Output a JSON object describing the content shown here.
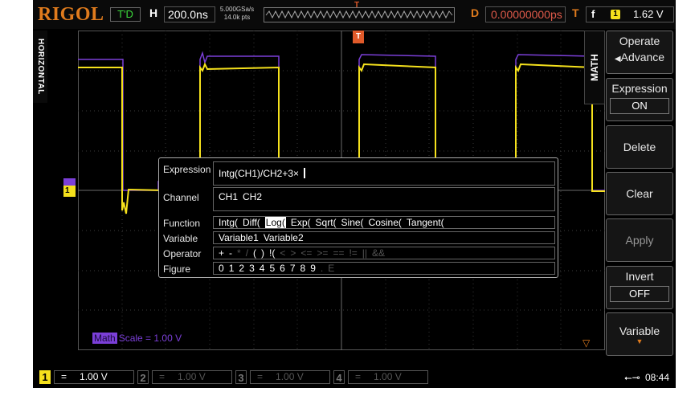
{
  "brand": "RIGOL",
  "top": {
    "run_status": "T'D",
    "h_label": "H",
    "timebase": "200.0ns",
    "sample_rate": "5.000GSa/s",
    "mem_depth": "14.0k pts",
    "trigger_marker": "T",
    "d_label": "D",
    "delay": "0.00000000ps",
    "t_label": "T",
    "trigger_edge": "f",
    "trigger_source": "1",
    "trigger_level": "1.62 V"
  },
  "left_label": "HORIZONTAL",
  "ch1_marker": "1",
  "grid_trigger_marker": "T",
  "math_scale": {
    "tag": "Math",
    "text": "Scale = 1.00 V"
  },
  "dialog": {
    "expression": {
      "label": "Expression",
      "value": "Intg(CH1)/CH2+3×"
    },
    "channel": {
      "label": "Channel",
      "items": [
        "CH1",
        "CH2"
      ]
    },
    "function": {
      "label": "Function",
      "items": [
        "Intg(",
        "Diff(",
        "Log(",
        "Exp(",
        "Sqrt(",
        "Sine(",
        "Cosine(",
        "Tangent("
      ],
      "selected_index": 2
    },
    "variable": {
      "label": "Variable",
      "items": [
        "Variable1",
        "Variable2"
      ]
    },
    "operator": {
      "label": "Operator",
      "active": [
        "+",
        "-"
      ],
      "inactive": [
        "*",
        "/",
        "(",
        ")",
        "!(",
        "<",
        ">",
        "<=",
        ">=",
        "==",
        "!=",
        "||",
        "&&"
      ]
    },
    "figure": {
      "label": "Figure",
      "digits": [
        "0",
        "1",
        "2",
        "3",
        "4",
        "5",
        "6",
        "7",
        "8",
        "9"
      ],
      "dim": [
        ".",
        "E"
      ]
    }
  },
  "menu": {
    "tab": "MATH",
    "operate_label": "Operate",
    "operate_value": "Advance",
    "expression_label": "Expression",
    "expression_value": "ON",
    "delete_label": "Delete",
    "clear_label": "Clear",
    "apply_label": "Apply",
    "invert_label": "Invert",
    "invert_value": "OFF",
    "variable_label": "Variable"
  },
  "channels": [
    {
      "num": "1",
      "coupling": "=",
      "scale": "1.00 V",
      "color": "#f5e11c",
      "active": true
    },
    {
      "num": "2",
      "coupling": "=",
      "scale": "1.00 V",
      "color": "#555555",
      "active": false
    },
    {
      "num": "3",
      "coupling": "=",
      "scale": "1.00 V",
      "color": "#555555",
      "active": false
    },
    {
      "num": "4",
      "coupling": "=",
      "scale": "1.00 V",
      "color": "#555555",
      "active": false
    }
  ],
  "clock": "08:44",
  "colors": {
    "ch1": "#f5e11c",
    "math": "#7b3fd8",
    "accent": "#e07b1d",
    "trigger": "#e05a2a"
  }
}
